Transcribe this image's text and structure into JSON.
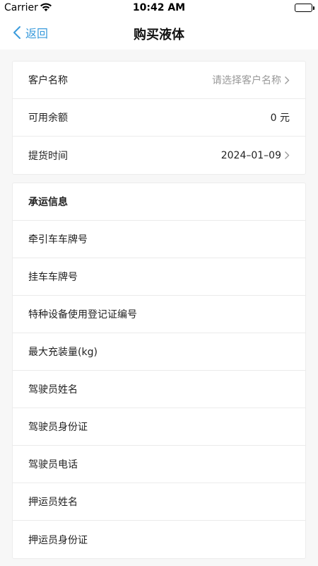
{
  "status_bar": {
    "carrier": "Carrier",
    "time": "10:42 AM"
  },
  "nav": {
    "back_label": "返回",
    "title": "购买液体"
  },
  "order_info": {
    "customer_label": "客户名称",
    "customer_placeholder": "请选择客户名称",
    "balance_label": "可用余额",
    "balance_value": "0 元",
    "pickup_label": "提货时间",
    "pickup_value": "2024–01–09"
  },
  "carrier_info": {
    "section_title": "承运信息",
    "fields": [
      "牵引车车牌号",
      "挂车车牌号",
      "特种设备使用登记证编号",
      "最大充装量(kg)",
      "驾驶员姓名",
      "驾驶员身份证",
      "驾驶员电话",
      "押运员姓名",
      "押运员身份证"
    ]
  },
  "colors": {
    "accent": "#3a9bdc",
    "background": "#f7f7f7",
    "placeholder": "#999999"
  }
}
